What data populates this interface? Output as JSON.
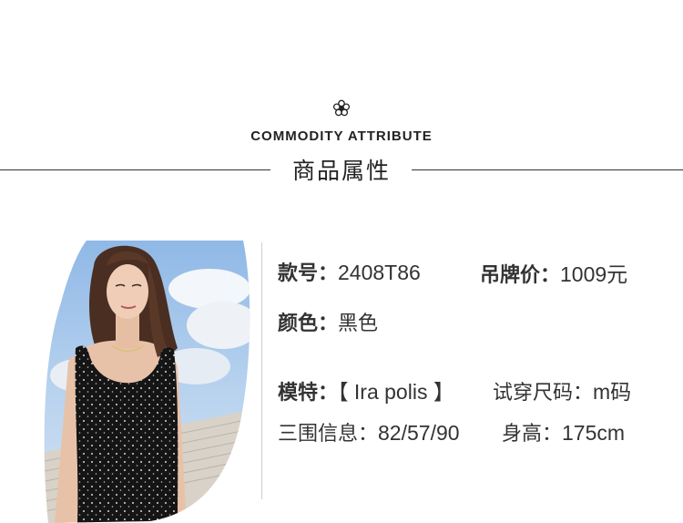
{
  "header": {
    "icon": "flower-icon",
    "title_en": "COMMODITY ATTRIBUTE",
    "title_cn": "商品属性"
  },
  "product": {
    "model_no_label": "款号：",
    "model_no": "2408T86",
    "tag_price_label": "吊牌价：",
    "tag_price": "1009元",
    "color_label": "颜色：",
    "color": "黑色"
  },
  "model_info": {
    "model_label": "模特：",
    "model_name": "【 Ira polis 】",
    "size_label": "试穿尺码：",
    "size": "m码",
    "measurements_label": "三围信息：",
    "measurements": "82/57/90",
    "height_label": "身高：",
    "height": "175cm"
  }
}
